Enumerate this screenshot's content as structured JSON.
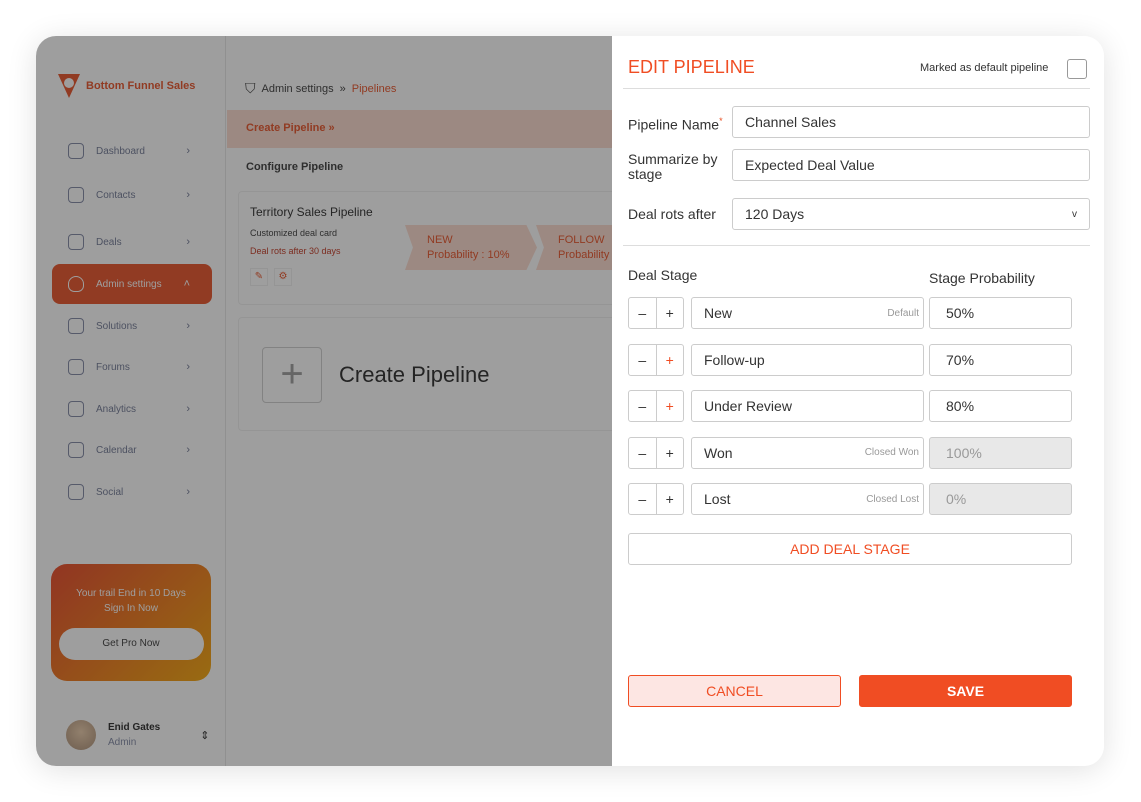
{
  "brand": {
    "name": "Bottom Funnel Sales",
    "accent": "#e84c1f"
  },
  "sidebar": {
    "items": [
      {
        "label": "Dashboard",
        "icon": "dashboard-icon"
      },
      {
        "label": "Contacts",
        "icon": "contacts-icon"
      },
      {
        "label": "Deals",
        "icon": "dollar-icon"
      },
      {
        "label": "Admin settings",
        "icon": "shield-user-icon",
        "active": true
      },
      {
        "label": "Solutions",
        "icon": "chart-icon"
      },
      {
        "label": "Forums",
        "icon": "document-icon"
      },
      {
        "label": "Analytics",
        "icon": "bar-chart-icon"
      },
      {
        "label": "Calendar",
        "icon": "calendar-icon"
      },
      {
        "label": "Social",
        "icon": "chat-icon"
      }
    ],
    "promo": {
      "line1": "Your trail End in 10 Days",
      "line2": "Sign In Now",
      "button": "Get Pro Now"
    },
    "user": {
      "name": "Enid Gates",
      "role": "Admin"
    }
  },
  "main": {
    "breadcrumb": {
      "parent": "Admin settings",
      "current": "Pipelines"
    },
    "create_bar": "Create Pipeline",
    "section_title": "Configure Pipeline",
    "pipeline_card": {
      "title": "Territory Sales Pipeline",
      "subtitle": "Customized deal card",
      "rot": "Deal rots after 30 days",
      "stages": [
        {
          "name": "NEW",
          "prob": "Probability : 10%"
        },
        {
          "name": "FOLLOW",
          "prob": "Probability"
        }
      ]
    },
    "create_card": "Create Pipeline"
  },
  "drawer": {
    "title": "EDIT PIPELINE",
    "default_label": "Marked as default pipeline",
    "default_checked": false,
    "name_label": "Pipeline Name",
    "required": "*",
    "name_value": "Channel Sales",
    "summarize_label": "Summarize by stage",
    "summarize_value": "Expected Deal Value",
    "rot_label": "Deal rots after",
    "rot_value": "120 Days",
    "stage_header": "Deal Stage",
    "prob_header": "Stage Probability",
    "stages": [
      {
        "name": "New",
        "tag": "Default",
        "prob": "50%",
        "disabled": false
      },
      {
        "name": "Follow-up",
        "tag": "",
        "prob": "70%",
        "disabled": false
      },
      {
        "name": "Under Review",
        "tag": "",
        "prob": "80%",
        "disabled": false
      },
      {
        "name": "Won",
        "tag": "Closed Won",
        "prob": "100%",
        "disabled": true
      },
      {
        "name": "Lost",
        "tag": "Closed Lost",
        "prob": "0%",
        "disabled": true
      }
    ],
    "minus": "–",
    "plus": "+",
    "add_stage": "ADD DEAL STAGE",
    "cancel": "CANCEL",
    "save": "SAVE"
  }
}
